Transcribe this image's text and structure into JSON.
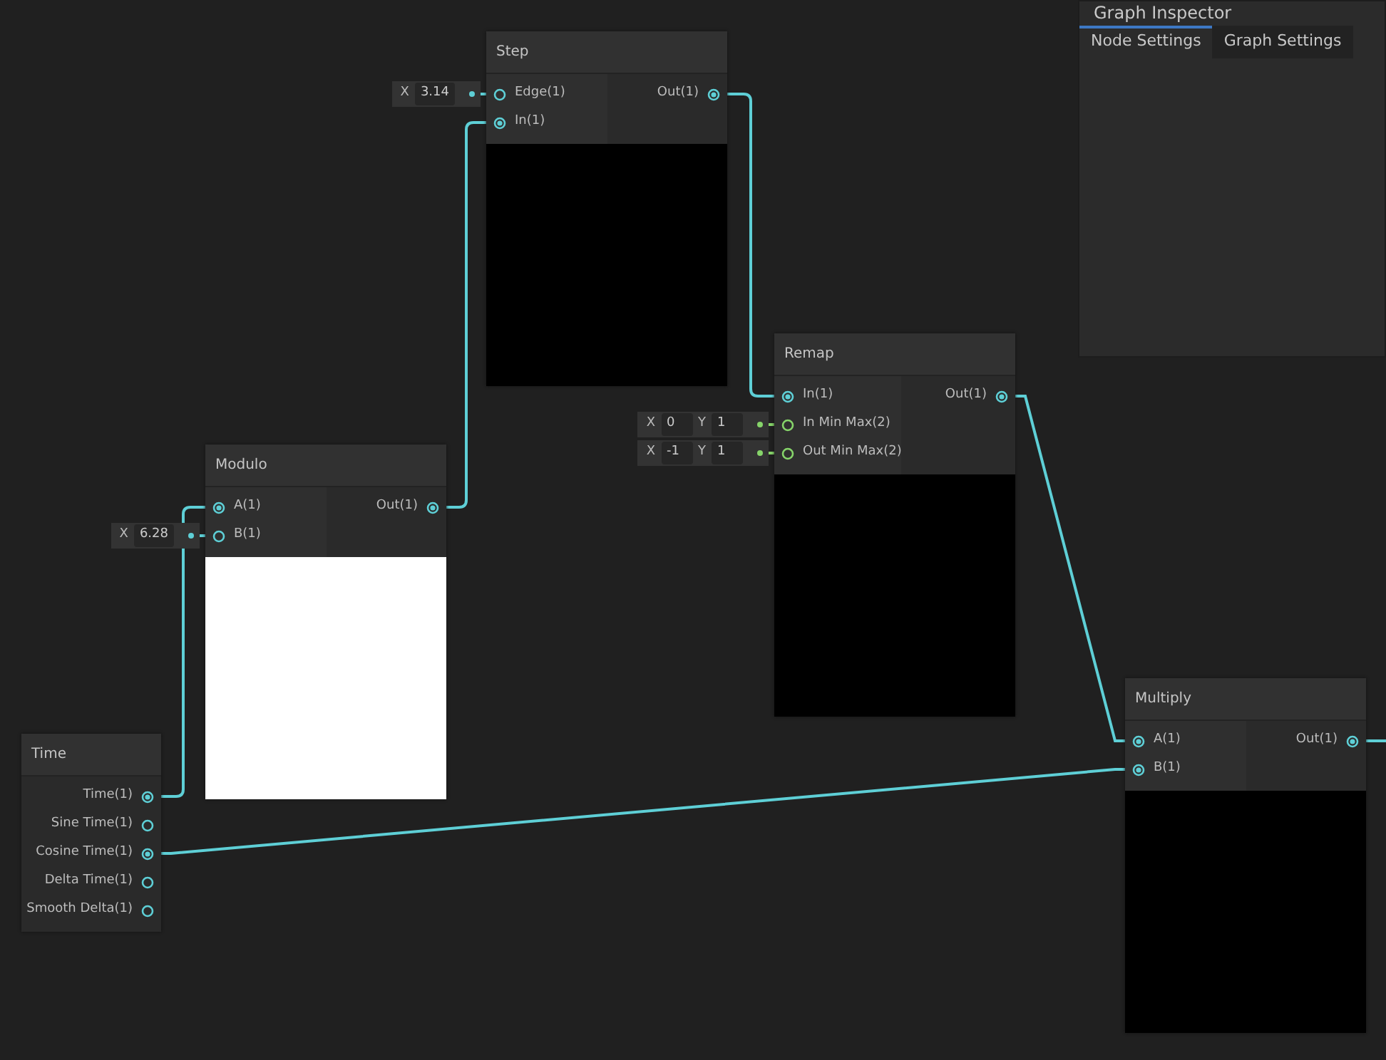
{
  "inspector": {
    "title": "Graph Inspector",
    "tabs": [
      {
        "label": "Node Settings",
        "selected": true
      },
      {
        "label": "Graph Settings",
        "selected": false
      }
    ]
  },
  "nodes": [
    {
      "title": "Step",
      "kind": "dark",
      "inputs": [
        {
          "label": "Edge(1)",
          "connected": false,
          "color": "#5ecfd6",
          "inline": [
            {
              "axis": "X",
              "value": "3.14"
            }
          ]
        },
        {
          "label": "In(1)",
          "connected": true,
          "color": "#5ecfd6"
        }
      ],
      "outputs": [
        {
          "label": "Out(1)",
          "connected": true,
          "color": "#5ecfd6"
        }
      ]
    },
    {
      "title": "Remap",
      "kind": "dark",
      "inputs": [
        {
          "label": "In(1)",
          "connected": true,
          "color": "#5ecfd6"
        },
        {
          "label": "In Min Max(2)",
          "connected": false,
          "color": "#86d46a",
          "inline": [
            {
              "axis": "X",
              "value": "0"
            },
            {
              "axis": "Y",
              "value": "1"
            }
          ]
        },
        {
          "label": "Out Min Max(2)",
          "connected": false,
          "color": "#86d46a",
          "inline": [
            {
              "axis": "X",
              "value": "-1"
            },
            {
              "axis": "Y",
              "value": "1"
            }
          ]
        }
      ],
      "outputs": [
        {
          "label": "Out(1)",
          "connected": true,
          "color": "#5ecfd6"
        }
      ]
    },
    {
      "title": "Modulo",
      "kind": "light",
      "inputs": [
        {
          "label": "A(1)",
          "connected": true,
          "color": "#5ecfd6"
        },
        {
          "label": "B(1)",
          "connected": false,
          "color": "#5ecfd6",
          "inline": [
            {
              "axis": "X",
              "value": "6.28"
            }
          ]
        }
      ],
      "outputs": [
        {
          "label": "Out(1)",
          "connected": true,
          "color": "#5ecfd6"
        }
      ]
    },
    {
      "title": "Time",
      "kind": "plain",
      "outputs": [
        {
          "label": "Time(1)",
          "connected": true,
          "color": "#5ecfd6"
        },
        {
          "label": "Sine Time(1)",
          "connected": false,
          "color": "#5ecfd6"
        },
        {
          "label": "Cosine Time(1)",
          "connected": true,
          "color": "#5ecfd6"
        },
        {
          "label": "Delta Time(1)",
          "connected": false,
          "color": "#5ecfd6"
        },
        {
          "label": "Smooth Delta(1)",
          "connected": false,
          "color": "#5ecfd6"
        }
      ]
    },
    {
      "title": "Multiply",
      "kind": "dark",
      "inputs": [
        {
          "label": "A(1)",
          "connected": true,
          "color": "#5ecfd6"
        },
        {
          "label": "B(1)",
          "connected": true,
          "color": "#5ecfd6"
        }
      ],
      "outputs": [
        {
          "label": "Out(1)",
          "connected": true,
          "color": "#5ecfd6"
        }
      ]
    }
  ]
}
